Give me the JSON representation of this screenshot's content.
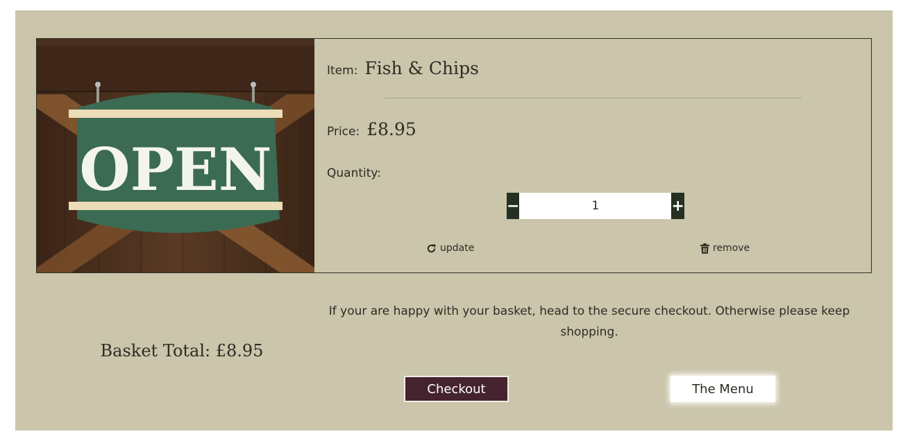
{
  "basket_item": {
    "image_alt": "Open sign on wooden door",
    "sign_text": "OPEN",
    "item_label": "Item:",
    "item_name": "Fish & Chips",
    "price_label": "Price:",
    "price_value": "£8.95",
    "quantity_label": "Quantity:",
    "quantity_value": "1",
    "decrement_symbol": "−",
    "increment_symbol": "+",
    "update_label": "update",
    "update_icon": "redo-icon",
    "remove_label": "remove",
    "remove_icon": "trash-icon"
  },
  "summary": {
    "message": "If your are happy with your basket, head to the secure checkout. Otherwise please keep shopping.",
    "total_text": "Basket Total: £8.95"
  },
  "actions": {
    "checkout_label": "Checkout",
    "menu_label": "The Menu"
  },
  "colors": {
    "panel_bg": "#cac5ab",
    "dark_green": "#253023",
    "checkout_bg": "#45232f",
    "text": "#2c2c22"
  }
}
